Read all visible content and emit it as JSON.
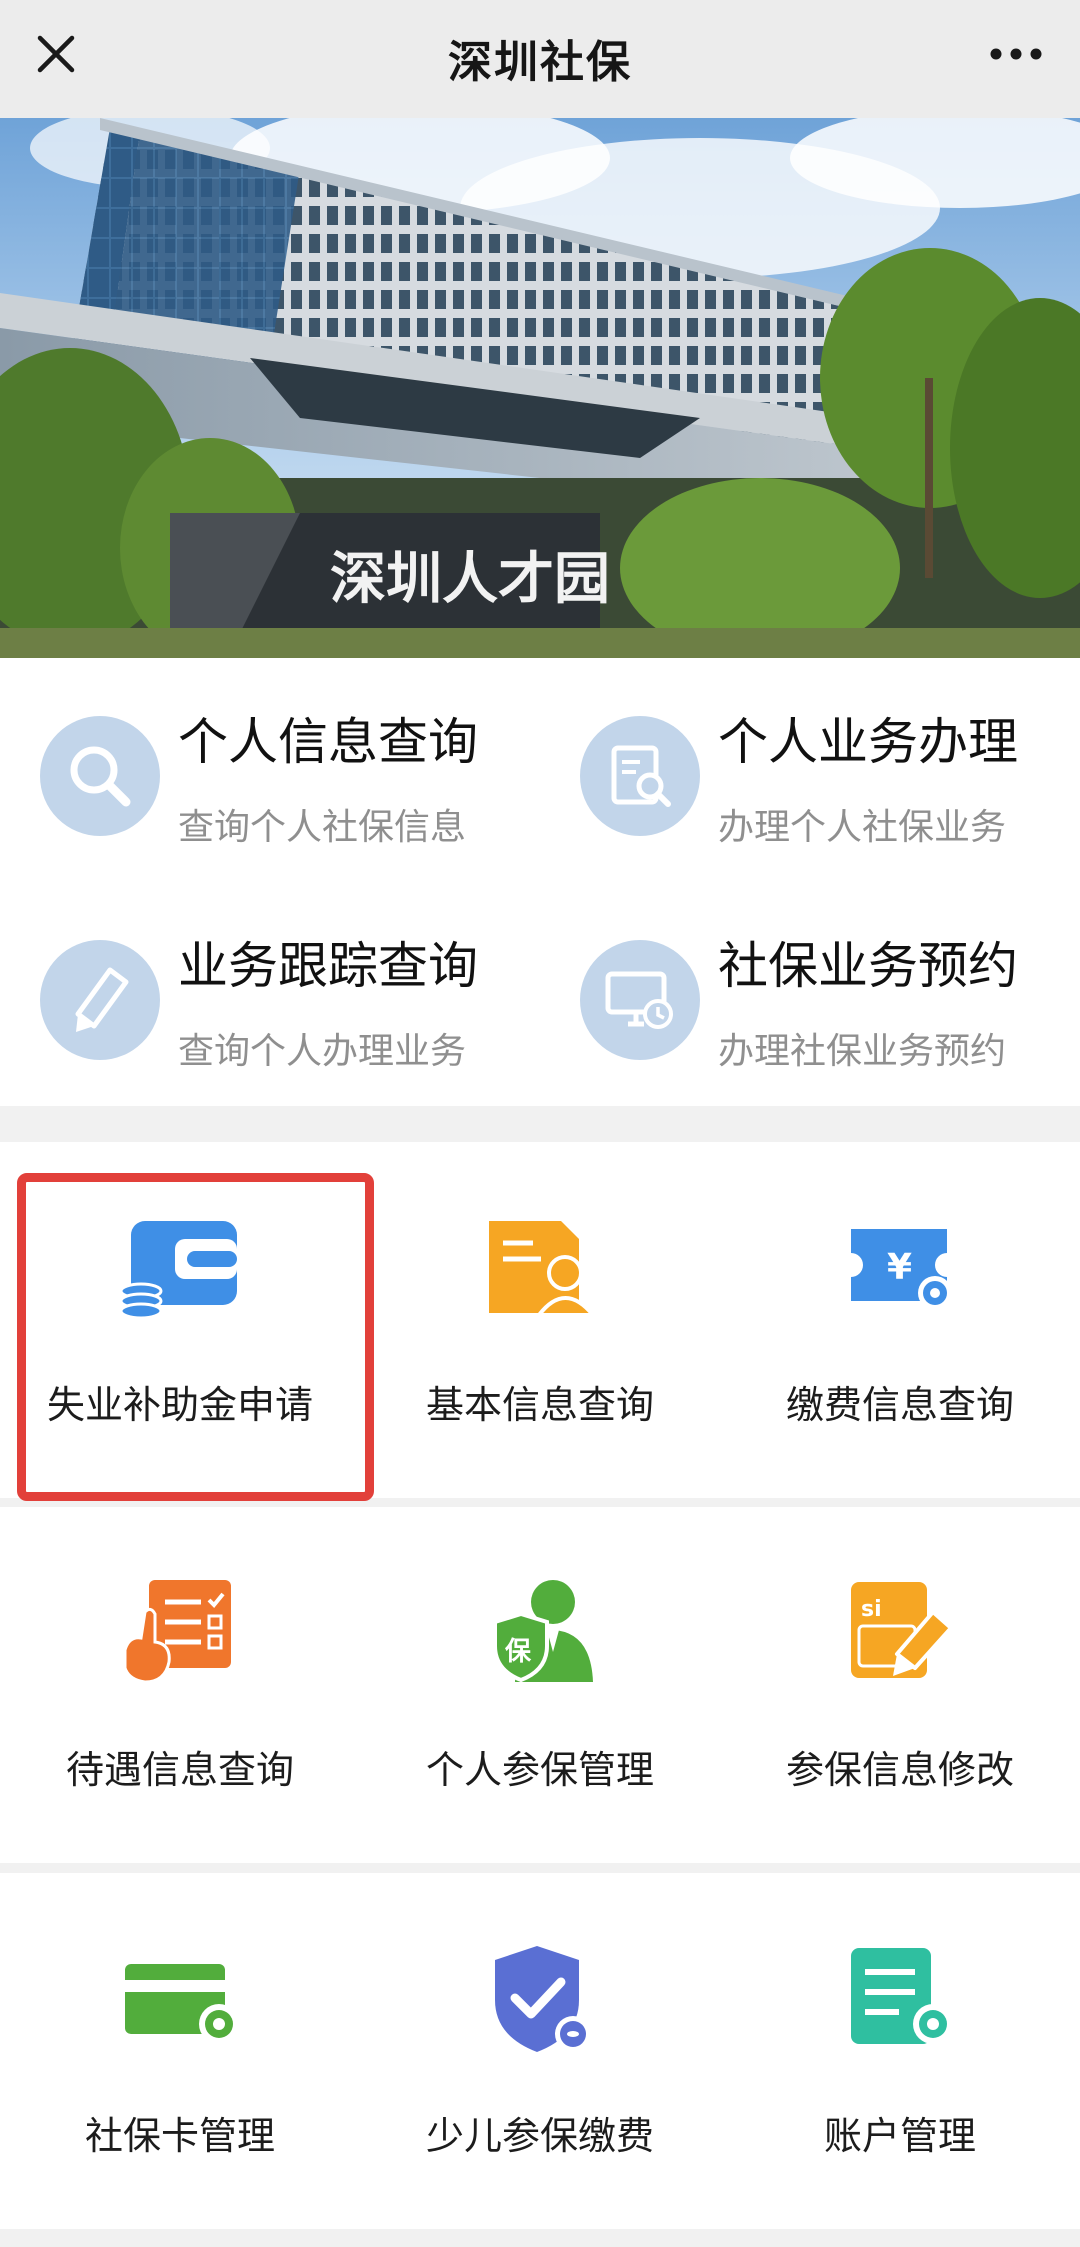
{
  "header": {
    "title": "深圳社保"
  },
  "banner": {
    "sign_text": "深圳人才园"
  },
  "quick_services": [
    {
      "title": "个人信息查询",
      "subtitle": "查询个人社保信息",
      "icon": "search-icon"
    },
    {
      "title": "个人业务办理",
      "subtitle": "办理个人社保业务",
      "icon": "document-search-icon"
    },
    {
      "title": "业务跟踪查询",
      "subtitle": "查询个人办理业务",
      "icon": "pencil-icon"
    },
    {
      "title": "社保业务预约",
      "subtitle": "办理社保业务预约",
      "icon": "monitor-clock-icon"
    }
  ],
  "services": [
    {
      "label": "失业补助金申请",
      "icon": "wallet-coins-icon",
      "highlighted": true
    },
    {
      "label": "基本信息查询",
      "icon": "profile-card-icon"
    },
    {
      "label": "缴费信息查询",
      "icon": "payment-ticket-icon"
    },
    {
      "label": "待遇信息查询",
      "icon": "checklist-hand-icon"
    },
    {
      "label": "个人参保管理",
      "icon": "insured-person-icon"
    },
    {
      "label": "参保信息修改",
      "icon": "edit-document-icon"
    },
    {
      "label": "社保卡管理",
      "icon": "card-gear-icon"
    },
    {
      "label": "少儿参保缴费",
      "icon": "shield-check-icon"
    },
    {
      "label": "账户管理",
      "icon": "account-list-icon"
    }
  ],
  "colors": {
    "highlight": "#e2403a",
    "quick_icon_bg": "#c2d5ea",
    "blue": "#3f8fe6",
    "orange": "#f6a623",
    "orange_red": "#f0762c",
    "green": "#52ad3c",
    "teal": "#2fbfa0",
    "indigo": "#5a6fd3"
  }
}
